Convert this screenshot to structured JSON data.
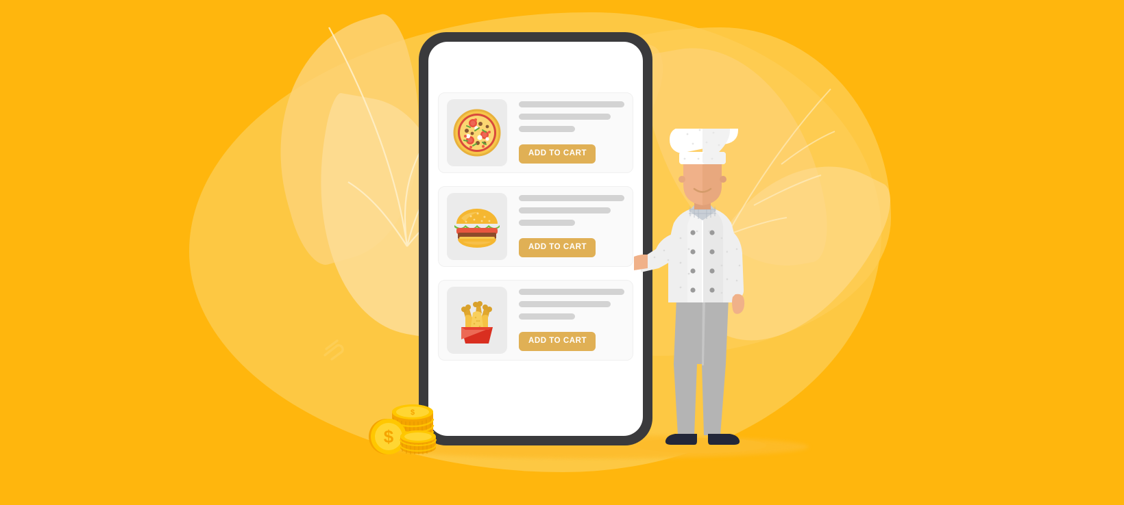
{
  "meta": {
    "illustration_title": "Food ordering mobile app illustration with chef",
    "background_color": "#FFB60D",
    "accent_color": "#F9A31B",
    "button_color": "#E0B055",
    "phone_frame_color": "#3A3A3C"
  },
  "storefront": {
    "awning_scallop_count": 7,
    "awning_color": "#F9A31B",
    "awning_top_color": "#FBB118"
  },
  "app": {
    "products": [
      {
        "icon": "pizza-icon",
        "name_placeholder_widths": [
          "100%",
          "87%",
          "53%"
        ],
        "button_label": "ADD TO CART"
      },
      {
        "icon": "burger-icon",
        "name_placeholder_widths": [
          "100%",
          "87%",
          "53%"
        ],
        "button_label": "ADD TO CART"
      },
      {
        "icon": "fried-chicken-bucket-icon",
        "name_placeholder_widths": [
          "100%",
          "87%",
          "53%"
        ],
        "button_label": "ADD TO CART"
      }
    ]
  },
  "character": {
    "name": "chef",
    "hat": "chef-hat-icon",
    "uniform_color": "#EFEFEF",
    "pants_color": "#B4B4B4",
    "shoes_color": "#232739",
    "skin_color": "#F0B189",
    "pose": "presenting-phone"
  },
  "decor": {
    "coins": {
      "name": "gold-coin-stack",
      "coin_color": "#FFC700",
      "coin_edge_color": "#F5A400",
      "symbol": "$"
    },
    "leaves": {
      "count": 5,
      "color": "#FDD275"
    },
    "watermark": {
      "name": "watermark-logo",
      "color": "#FFD76B"
    }
  }
}
